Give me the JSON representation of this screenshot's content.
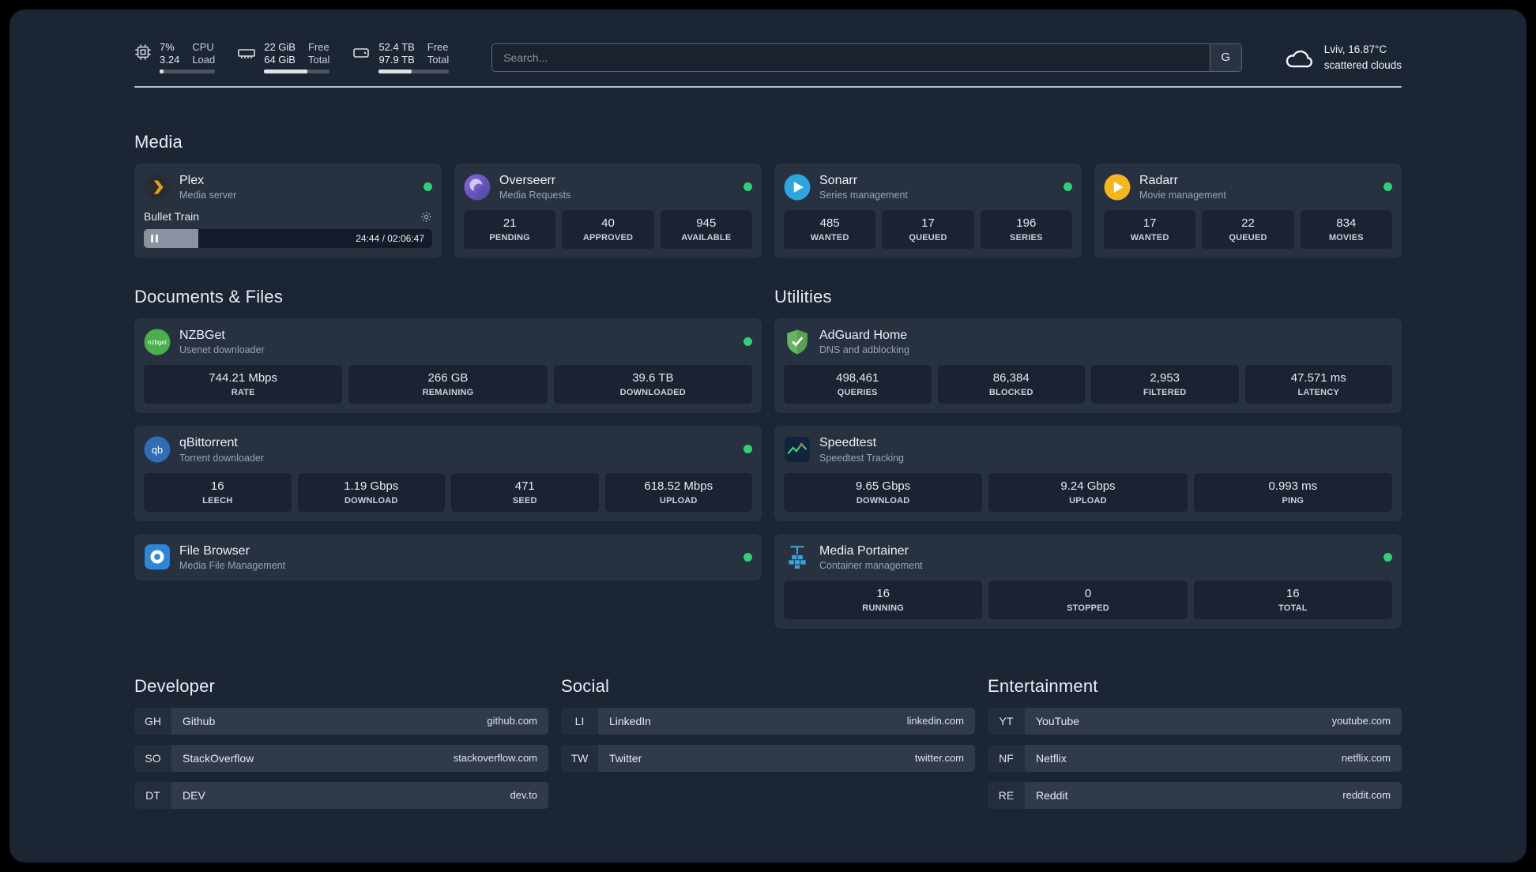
{
  "topbar": {
    "cpu": {
      "value_top": "7%",
      "label_top": "CPU",
      "value_bottom": "3.24",
      "label_bottom": "Load",
      "bar_style": "width:7%"
    },
    "ram": {
      "value_top": "22 GiB",
      "label_top": "Free",
      "value_bottom": "64 GiB",
      "label_bottom": "Total",
      "bar_style": "width:66%"
    },
    "disk": {
      "value_top": "52.4 TB",
      "label_top": "Free",
      "value_bottom": "97.9 TB",
      "label_bottom": "Total",
      "bar_style": "width:47%"
    },
    "search": {
      "placeholder": "Search...",
      "provider_label": "G"
    },
    "weather": {
      "location": "Lviv, 16.87°C",
      "condition": "scattered clouds"
    }
  },
  "sections": {
    "media": "Media",
    "documents": "Documents & Files",
    "utilities": "Utilities",
    "developer": "Developer",
    "social": "Social",
    "entertainment": "Entertainment"
  },
  "services": {
    "plex": {
      "name": "Plex",
      "subtitle": "Media server",
      "now_playing": "Bullet Train",
      "time": "24:44 / 02:06:47",
      "progress_style": "width:19%"
    },
    "overseerr": {
      "name": "Overseerr",
      "subtitle": "Media Requests",
      "stats": [
        {
          "value": "21",
          "label": "PENDING"
        },
        {
          "value": "40",
          "label": "APPROVED"
        },
        {
          "value": "945",
          "label": "AVAILABLE"
        }
      ]
    },
    "sonarr": {
      "name": "Sonarr",
      "subtitle": "Series management",
      "stats": [
        {
          "value": "485",
          "label": "WANTED"
        },
        {
          "value": "17",
          "label": "QUEUED"
        },
        {
          "value": "196",
          "label": "SERIES"
        }
      ]
    },
    "radarr": {
      "name": "Radarr",
      "subtitle": "Movie management",
      "stats": [
        {
          "value": "17",
          "label": "WANTED"
        },
        {
          "value": "22",
          "label": "QUEUED"
        },
        {
          "value": "834",
          "label": "MOVIES"
        }
      ]
    },
    "nzbget": {
      "name": "NZBGet",
      "subtitle": "Usenet downloader",
      "stats": [
        {
          "value": "744.21 Mbps",
          "label": "RATE"
        },
        {
          "value": "266 GB",
          "label": "REMAINING"
        },
        {
          "value": "39.6 TB",
          "label": "DOWNLOADED"
        }
      ]
    },
    "qbittorrent": {
      "name": "qBittorrent",
      "subtitle": "Torrent downloader",
      "stats": [
        {
          "value": "16",
          "label": "LEECH"
        },
        {
          "value": "1.19 Gbps",
          "label": "DOWNLOAD"
        },
        {
          "value": "471",
          "label": "SEED"
        },
        {
          "value": "618.52 Mbps",
          "label": "UPLOAD"
        }
      ]
    },
    "filebrowser": {
      "name": "File Browser",
      "subtitle": "Media File Management"
    },
    "adguard": {
      "name": "AdGuard Home",
      "subtitle": "DNS and adblocking",
      "stats": [
        {
          "value": "498,461",
          "label": "QUERIES"
        },
        {
          "value": "86,384",
          "label": "BLOCKED"
        },
        {
          "value": "2,953",
          "label": "FILTERED"
        },
        {
          "value": "47.571 ms",
          "label": "LATENCY"
        }
      ]
    },
    "speedtest": {
      "name": "Speedtest",
      "subtitle": "Speedtest Tracking",
      "stats": [
        {
          "value": "9.65 Gbps",
          "label": "DOWNLOAD"
        },
        {
          "value": "9.24 Gbps",
          "label": "UPLOAD"
        },
        {
          "value": "0.993 ms",
          "label": "PING"
        }
      ]
    },
    "portainer": {
      "name": "Media Portainer",
      "subtitle": "Container management",
      "stats": [
        {
          "value": "16",
          "label": "RUNNING"
        },
        {
          "value": "0",
          "label": "STOPPED"
        },
        {
          "value": "16",
          "label": "TOTAL"
        }
      ]
    }
  },
  "bookmarks": {
    "developer": [
      {
        "abbr": "GH",
        "name": "Github",
        "url": "github.com"
      },
      {
        "abbr": "SO",
        "name": "StackOverflow",
        "url": "stackoverflow.com"
      },
      {
        "abbr": "DT",
        "name": "DEV",
        "url": "dev.to"
      }
    ],
    "social": [
      {
        "abbr": "LI",
        "name": "LinkedIn",
        "url": "linkedin.com"
      },
      {
        "abbr": "TW",
        "name": "Twitter",
        "url": "twitter.com"
      }
    ],
    "entertainment": [
      {
        "abbr": "YT",
        "name": "YouTube",
        "url": "youtube.com"
      },
      {
        "abbr": "NF",
        "name": "Netflix",
        "url": "netflix.com"
      },
      {
        "abbr": "RE",
        "name": "Reddit",
        "url": "reddit.com"
      }
    ]
  },
  "colors": {
    "status_online": "#2ed173",
    "background": "#1c2534",
    "card": "#273140"
  }
}
